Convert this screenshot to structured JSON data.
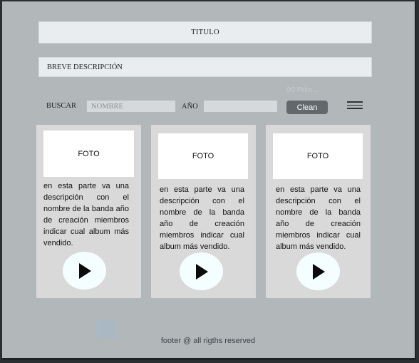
{
  "header": {
    "title": "TITULO"
  },
  "description": {
    "text": "BREVE DESCRIPCIÓN"
  },
  "search": {
    "buscar_label": "BUSCAR",
    "name_placeholder": "NOMBRE",
    "year_label": "AÑO",
    "year_value": "",
    "hint_text": "00 Prim...",
    "clean_label": "Clean",
    "menu_icon": "hamburger-menu-icon"
  },
  "cards": [
    {
      "photo_label": "FOTO",
      "description": "en esta parte va una descripción con el nombre de la banda año de creación miembros indicar cual album más vendido.",
      "play_icon": "play-icon"
    },
    {
      "photo_label": "FOTO",
      "description": "en esta parte va una descripción con el nombre de la banda año de creación miembros indicar cual album más vendido.",
      "play_icon": "play-icon"
    },
    {
      "photo_label": "FOTO",
      "description": "en esta parte va una descripción con el nombre de la banda año de creación miembros indicar cual album más vendido.",
      "play_icon": "play-icon"
    }
  ],
  "footer": {
    "text": "footer @ all rigths reserved"
  },
  "colors": {
    "background": "#b2b8ba",
    "bars": "#e9edf0",
    "cards": "#d9d9d9",
    "button": "#62686c",
    "play_circle": "#f4feff"
  }
}
